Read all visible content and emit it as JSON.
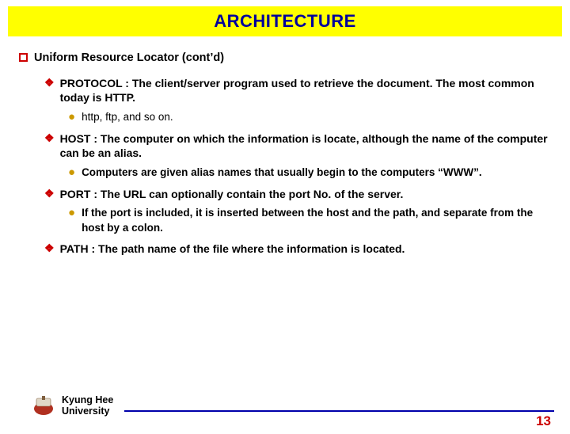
{
  "title": "ARCHITECTURE",
  "section": "Uniform Resource Locator (cont’d)",
  "items": [
    {
      "label": "PROTOCOL : The client/server program used to retrieve the document. The most common today is HTTP.",
      "sub": [
        {
          "text": "http, ftp, and so on.",
          "bold": false
        }
      ]
    },
    {
      "label": "HOST : The computer on which the information is locate, although the name of the computer can be an alias.",
      "sub": [
        {
          "text": "Computers are given alias names that usually begin to the computers “WWW”.",
          "bold": true
        }
      ]
    },
    {
      "label": "PORT : The URL can optionally contain the port No. of the server.",
      "sub": [
        {
          "text": "If the port is included, it is inserted between the host and the path, and separate from the host by a colon.",
          "bold": true
        }
      ]
    },
    {
      "label": "PATH : The path name of the file where the information is located.",
      "sub": []
    }
  ],
  "footer": {
    "uni_line1": "Kyung Hee",
    "uni_line2": "University",
    "page": "13"
  }
}
